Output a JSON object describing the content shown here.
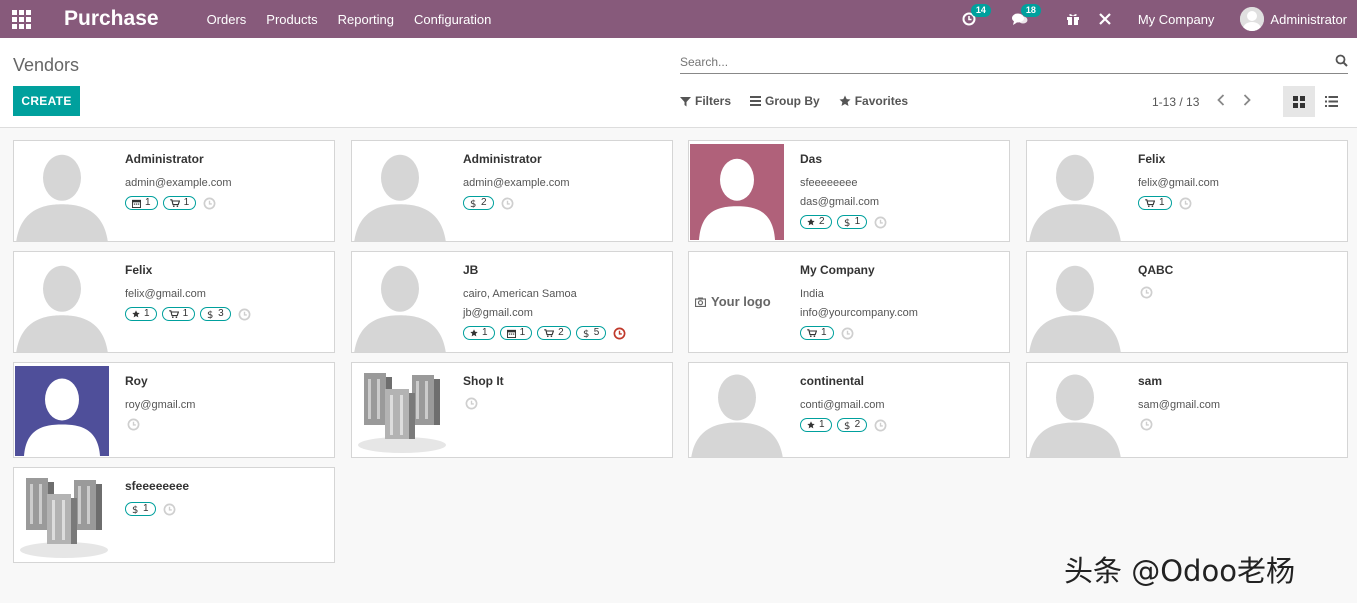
{
  "app": {
    "brand": "Purchase",
    "menu": [
      "Orders",
      "Products",
      "Reporting",
      "Configuration"
    ],
    "activity_count": "14",
    "message_count": "18",
    "company": "My Company",
    "user": "Administrator",
    "accent": "#875a7b",
    "primary": "#00a09d"
  },
  "control": {
    "breadcrumb": "Vendors",
    "create_label": "CREATE",
    "search_placeholder": "Search...",
    "filters_label": "Filters",
    "groupby_label": "Group By",
    "favorites_label": "Favorites",
    "pager": "1-13 / 13"
  },
  "cards": [
    {
      "name": "Administrator",
      "lines": [
        "admin@example.com"
      ],
      "tags": [
        {
          "icon": "calendar",
          "text": "1"
        },
        {
          "icon": "cart",
          "text": "1"
        }
      ],
      "img": "placeholder",
      "overdue": false
    },
    {
      "name": "Administrator",
      "lines": [
        "admin@example.com"
      ],
      "tags": [
        {
          "icon": "dollar",
          "text": "2"
        }
      ],
      "img": "placeholder",
      "overdue": false
    },
    {
      "name": "Das",
      "lines": [
        "sfeeeeeeee",
        "das@gmail.com"
      ],
      "tags": [
        {
          "icon": "star",
          "text": "2"
        },
        {
          "icon": "dollar",
          "text": "1"
        }
      ],
      "img": "avatar-pink",
      "overdue": false
    },
    {
      "name": "Felix",
      "lines": [
        "felix@gmail.com"
      ],
      "tags": [
        {
          "icon": "cart",
          "text": "1"
        }
      ],
      "img": "placeholder",
      "overdue": false
    },
    {
      "name": "Felix",
      "lines": [
        "felix@gmail.com"
      ],
      "tags": [
        {
          "icon": "star",
          "text": "1"
        },
        {
          "icon": "cart",
          "text": "1"
        },
        {
          "icon": "dollar",
          "text": "3"
        }
      ],
      "img": "placeholder",
      "overdue": false
    },
    {
      "name": "JB",
      "lines": [
        "cairo, American Samoa",
        "jb@gmail.com"
      ],
      "tags": [
        {
          "icon": "star",
          "text": "1"
        },
        {
          "icon": "calendar",
          "text": "1"
        },
        {
          "icon": "cart",
          "text": "2"
        },
        {
          "icon": "dollar",
          "text": "5"
        }
      ],
      "img": "placeholder",
      "overdue": true
    },
    {
      "name": "My Company",
      "lines": [
        "India",
        "info@yourcompany.com"
      ],
      "tags": [
        {
          "icon": "cart",
          "text": "1"
        }
      ],
      "img": "logo",
      "logo_text": "Your logo",
      "overdue": false
    },
    {
      "name": "QABC",
      "lines": [],
      "tags": [],
      "img": "placeholder",
      "overdue": false
    },
    {
      "name": "Roy",
      "lines": [
        "roy@gmail.cm"
      ],
      "tags": [],
      "img": "avatar-blue",
      "overdue": false
    },
    {
      "name": "Shop It",
      "lines": [],
      "tags": [],
      "img": "buildings",
      "overdue": false
    },
    {
      "name": "continental",
      "lines": [
        "conti@gmail.com"
      ],
      "tags": [
        {
          "icon": "star",
          "text": "1"
        },
        {
          "icon": "dollar",
          "text": "2"
        }
      ],
      "img": "placeholder",
      "overdue": false
    },
    {
      "name": "sam",
      "lines": [
        "sam@gmail.com"
      ],
      "tags": [],
      "img": "placeholder",
      "overdue": false
    },
    {
      "name": "sfeeeeeeee",
      "lines": [],
      "tags": [
        {
          "icon": "dollar",
          "text": "1"
        }
      ],
      "img": "buildings",
      "overdue": false
    }
  ],
  "watermark": "头条 @Odoo老杨"
}
